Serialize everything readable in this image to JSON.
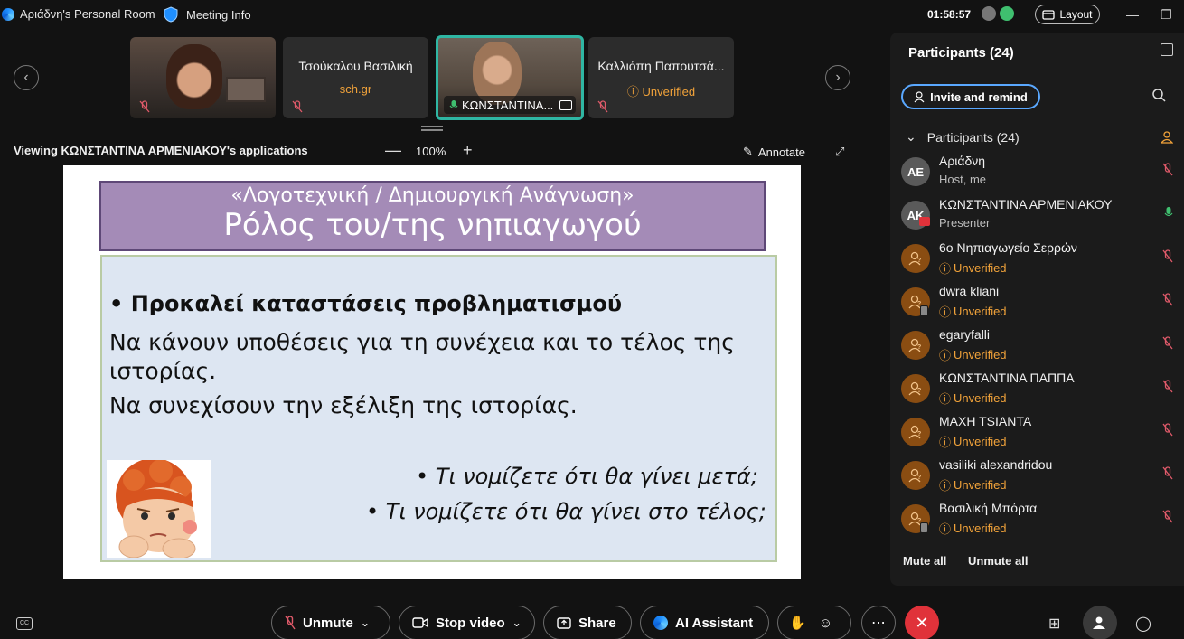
{
  "titlebar": {
    "room_title": "Αριάδνη's Personal Room",
    "meeting_info": "Meeting Info",
    "clock": "01:58:57",
    "layout_label": "Layout"
  },
  "filmstrip": {
    "tiles": [
      {
        "type": "video",
        "name": ""
      },
      {
        "type": "name",
        "name": "Τσούκαλου Βασιλική",
        "sub": "sch.gr"
      },
      {
        "type": "video-active",
        "name": "ΚΩΝΣΤΑΝΤΙΝΑ..."
      },
      {
        "type": "name",
        "name": "Καλλιόπη Παπουτσά...",
        "sub": "Unverified"
      }
    ]
  },
  "viewing": {
    "label": "Viewing ΚΩΝΣΤΑΝΤΙΝΑ ΑΡΜΕΝΙΑΚΟΥ's applications",
    "zoom": "100%",
    "annotate": "Annotate"
  },
  "slide": {
    "title_line1": "«Λογοτεχνική / Δημιουργική Ανάγνωση»",
    "title_line2": "Ρόλος του/της νηπιαγωγού",
    "bullet_bold": "•  Προκαλεί καταστάσεις προβληματισμού",
    "line1": "Να κάνουν υποθέσεις για τη συνέχεια και το τέλος της",
    "line1b": "ιστορίας.",
    "line2": "Να συνεχίσουν την εξέλιξη της ιστορίας.",
    "question1": "•   Τι νομίζετε  ότι θα γίνει μετά;",
    "question2": "•   Τι νομίζετε ότι θα γίνει στο τέλος;"
  },
  "participants_panel": {
    "title": "Participants (24)",
    "invite_label": "Invite and remind",
    "section_label": "Participants (24)",
    "mute_all": "Mute all",
    "unmute_all": "Unmute all",
    "list": [
      {
        "initials": "AE",
        "name": "Αριάδνη",
        "sub": "Host, me",
        "avatar": "gray",
        "mic": "muted"
      },
      {
        "initials": "AK",
        "name": "ΚΩΝΣΤΑΝΤΙΝΑ ΑΡΜΕΝΙΑΚΟΥ",
        "sub": "Presenter",
        "avatar": "gray",
        "mic": "active"
      },
      {
        "initials": "",
        "name": "6ο Νηπιαγωγείο Σερρών",
        "sub": "Unverified",
        "avatar": "orange",
        "mic": "muted"
      },
      {
        "initials": "",
        "name": "dwra kliani",
        "sub": "Unverified",
        "avatar": "orange",
        "mic": "muted"
      },
      {
        "initials": "",
        "name": "egaryfalli",
        "sub": "Unverified",
        "avatar": "orange",
        "mic": "muted"
      },
      {
        "initials": "",
        "name": "ΚΩΝΣΤΑΝΤΙΝΑ ΠΑΠΠΑ",
        "sub": "Unverified",
        "avatar": "orange",
        "mic": "muted"
      },
      {
        "initials": "",
        "name": "ΜΑΧΗ ΤSΙΑΝΤΑ",
        "sub": "Unverified",
        "avatar": "orange",
        "mic": "muted"
      },
      {
        "initials": "",
        "name": "vasiliki alexandridou",
        "sub": "Unverified",
        "avatar": "orange",
        "mic": "muted"
      },
      {
        "initials": "",
        "name": "Βασιλική Μπόρτα",
        "sub": "Unverified",
        "avatar": "orange",
        "mic": "muted"
      }
    ]
  },
  "controls": {
    "unmute": "Unmute",
    "stop_video": "Stop video",
    "share": "Share",
    "ai_assistant": "AI Assistant"
  },
  "colors": {
    "accent": "#5aa8ff",
    "unverified": "#f2a33a",
    "end_call": "#e0323a",
    "muted_mic": "#e05a6a",
    "active_mic": "#3fbf6f",
    "slide_title_bg": "#a48bb7",
    "slide_body_bg": "#dde6f2"
  }
}
